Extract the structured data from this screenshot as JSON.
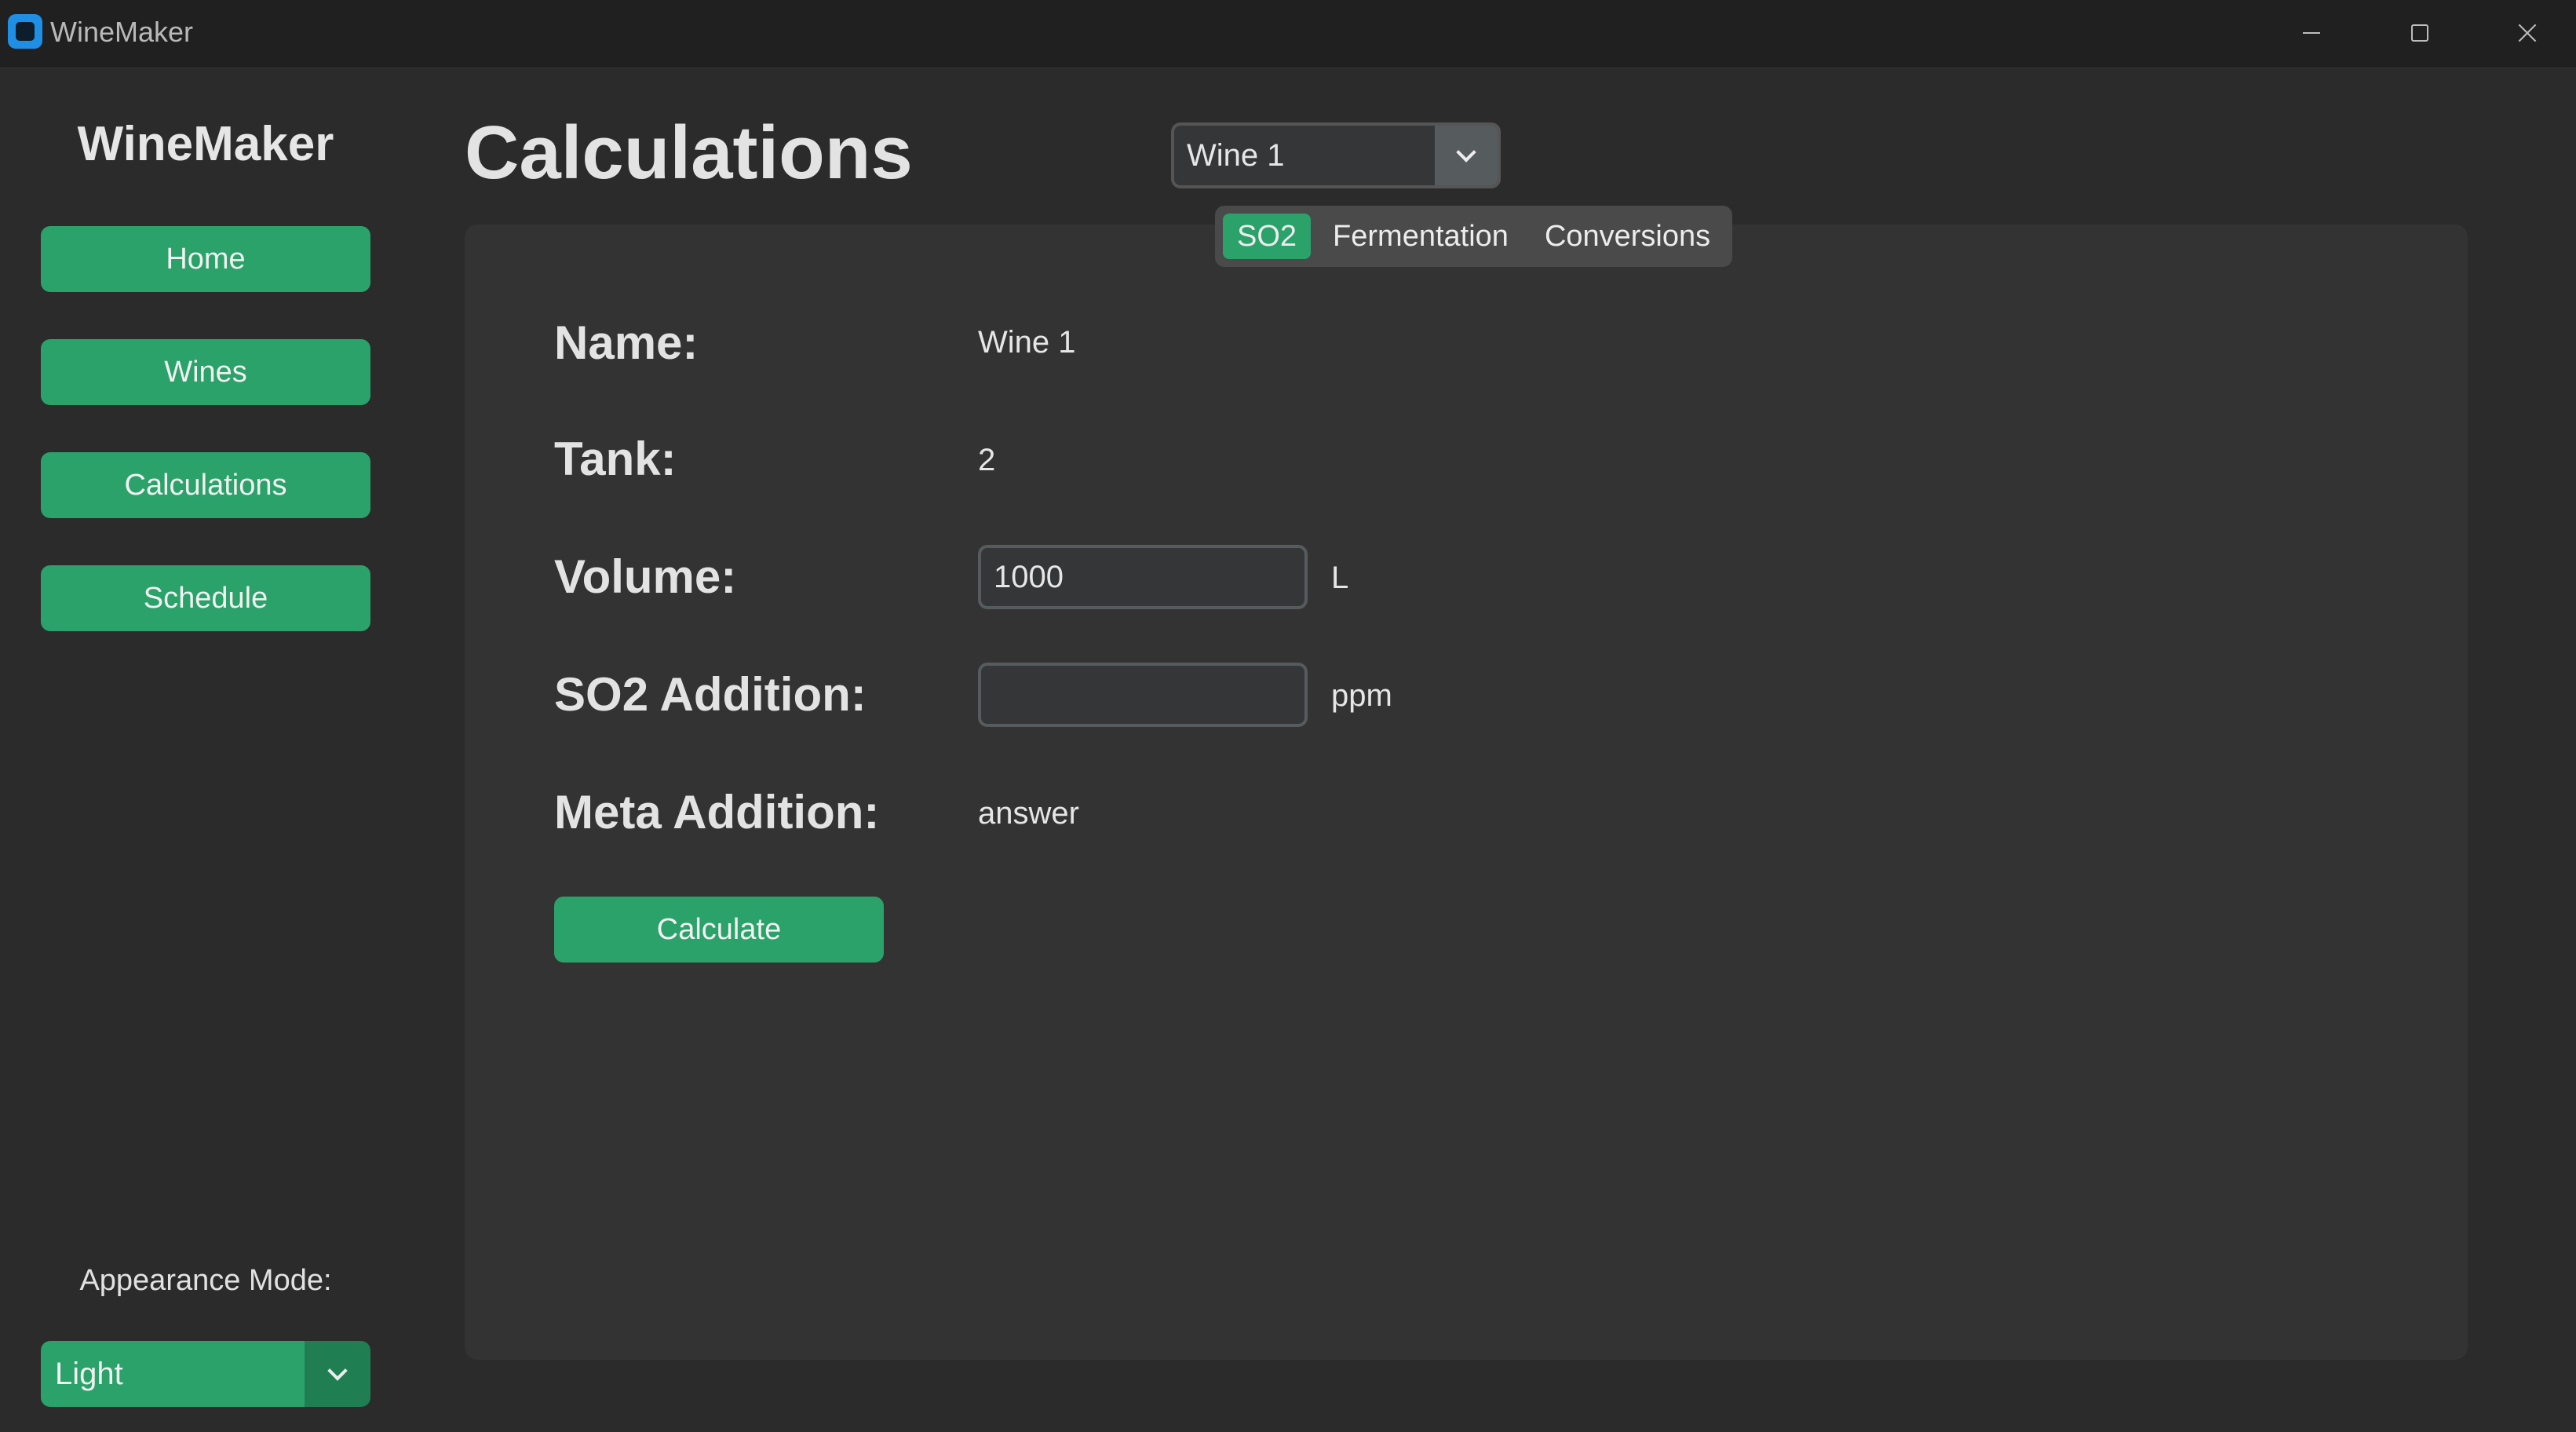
{
  "window": {
    "title": "WineMaker"
  },
  "sidebar": {
    "title": "WineMaker",
    "items": [
      {
        "label": "Home"
      },
      {
        "label": "Wines"
      },
      {
        "label": "Calculations"
      },
      {
        "label": "Schedule"
      }
    ],
    "appearance_label": "Appearance Mode:",
    "appearance_value": "Light"
  },
  "header": {
    "title": "Calculations",
    "wine_select_value": "Wine 1"
  },
  "tabs": [
    {
      "label": "SO2",
      "active": true
    },
    {
      "label": "Fermentation",
      "active": false
    },
    {
      "label": "Conversions",
      "active": false
    }
  ],
  "form": {
    "name_label": "Name:",
    "name_value": "Wine 1",
    "tank_label": "Tank:",
    "tank_value": "2",
    "volume_label": "Volume:",
    "volume_value": "1000",
    "volume_unit": "L",
    "so2_label": "SO2 Addition:",
    "so2_value": "",
    "so2_unit": "ppm",
    "meta_label": "Meta Addition:",
    "meta_value": "answer",
    "calculate_label": "Calculate"
  },
  "colors": {
    "accent": "#2aa26a",
    "background": "#2b2b2b",
    "panel": "#333333"
  }
}
